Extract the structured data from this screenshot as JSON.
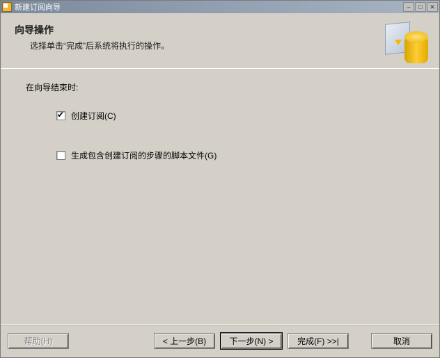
{
  "window": {
    "title": "新建订阅向导"
  },
  "header": {
    "title": "向导操作",
    "subtitle": "选择单击“完成”后系统将执行的操作。"
  },
  "content": {
    "section_label": "在向导结束时:",
    "checkbox1": {
      "label": "创建订阅(C)",
      "checked": true
    },
    "checkbox2": {
      "label": "生成包含创建订阅的步骤的脚本文件(G)",
      "checked": false
    }
  },
  "footer": {
    "help": "帮助(H)",
    "back": "< 上一步(B)",
    "next": "下一步(N) >",
    "finish": "完成(F) >>|",
    "cancel": "取消"
  }
}
